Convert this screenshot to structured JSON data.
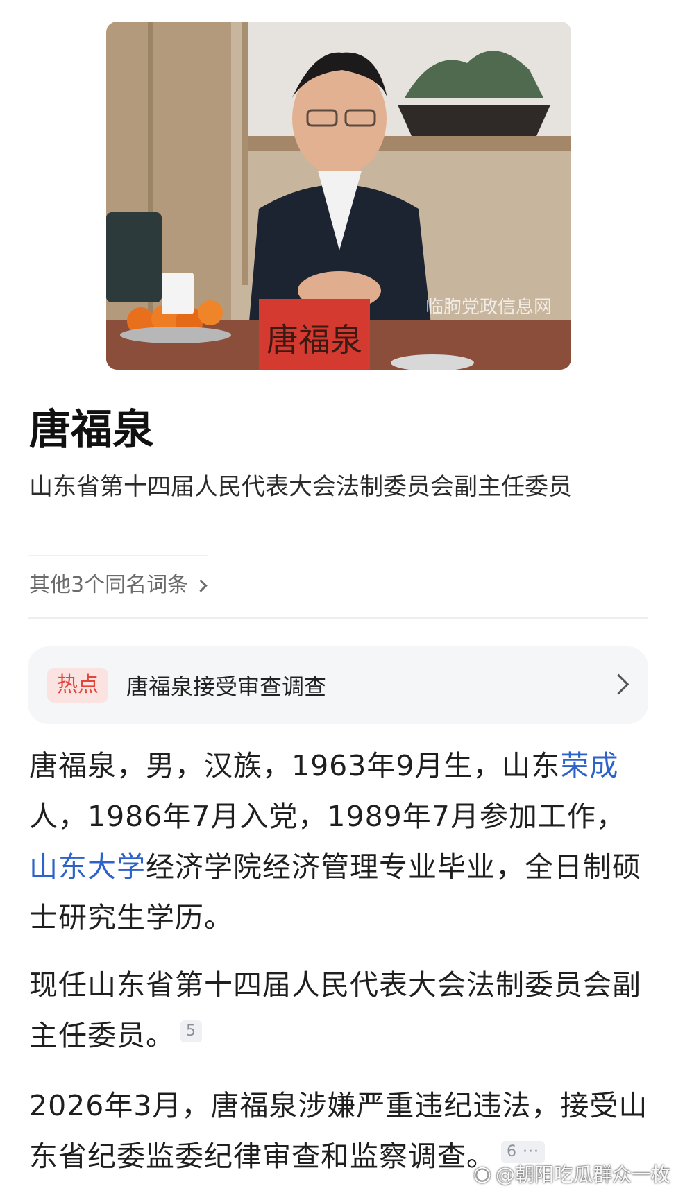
{
  "entry": {
    "portrait_alt": "唐福泉",
    "name": "唐福泉",
    "subtitle": "山东省第十四届人民代表大会法制委员会副主任委员",
    "same_name_link": "其他3个同名词条"
  },
  "hot": {
    "badge": "热点",
    "title": "唐福泉接受审查调查"
  },
  "body": {
    "p1": {
      "t1": "唐福泉，男，汉族，1963年9月生，山东",
      "link1": "荣成",
      "t2": "人，1986年7月入党，1989年7月参加工作，",
      "link2": "山东大学",
      "t3": "经济学院经济管理专业毕业，全日制硕士研究生学历。"
    },
    "p2": {
      "text": "现任山东省第十四届人民代表大会法制委员会副主任委员。",
      "ref": "5"
    },
    "p3": {
      "text": "2026年3月，唐福泉涉嫌严重违纪违法，接受山东省纪委监委纪律审查和监察调查。",
      "ref": "6 ···"
    }
  },
  "watermark": "@朝阳吃瓜群众一枚",
  "photo_caption": "临朐党政信息网",
  "photo_nameplate": "唐福泉",
  "colors": {
    "link": "#2c62c9",
    "hot_badge": "#e4453a",
    "hot_bg": "#fbe3e2"
  }
}
